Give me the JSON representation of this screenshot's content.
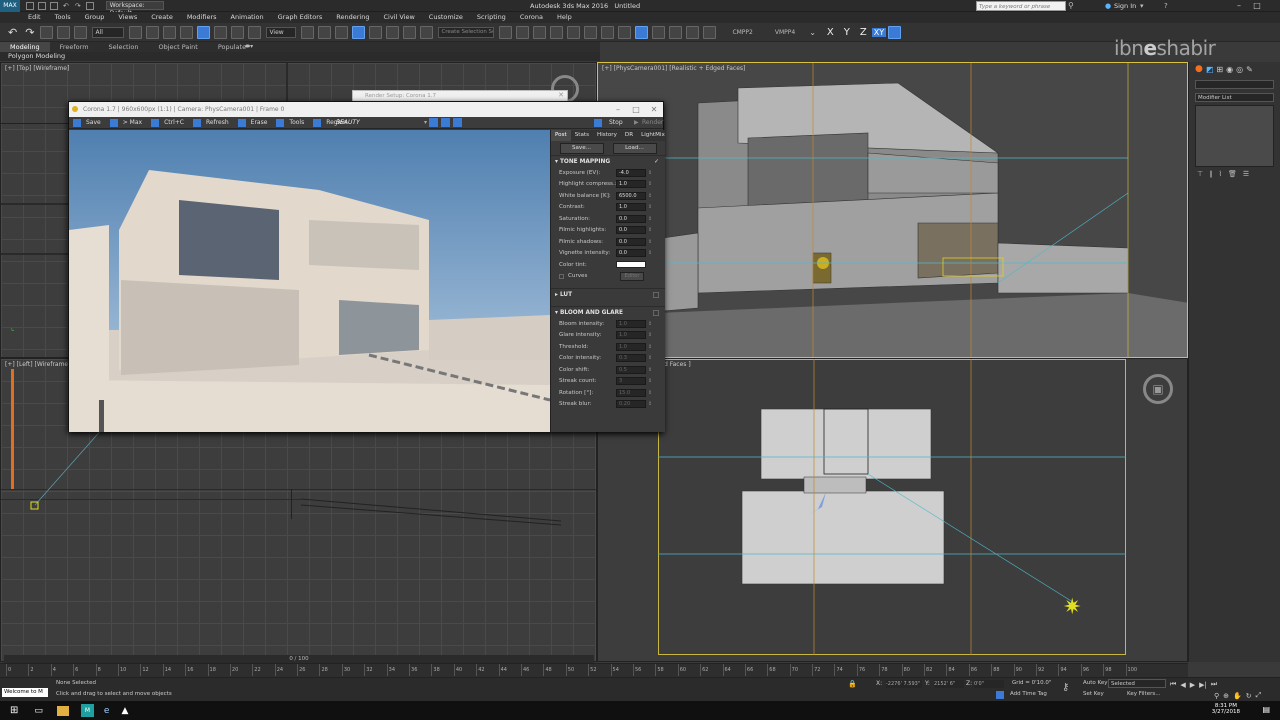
{
  "app": {
    "title": "Autodesk 3ds Max 2016",
    "doc_title": "Untitled",
    "workspace": "Workspace: Default",
    "search_placeholder": "Type a keyword or phrase",
    "sign_in": "Sign In",
    "watermark": "ibn e shabir"
  },
  "menu": [
    "Edit",
    "Tools",
    "Group",
    "Views",
    "Create",
    "Modifiers",
    "Animation",
    "Graph Editors",
    "Rendering",
    "Civil View",
    "Customize",
    "Scripting",
    "Corona",
    "Help"
  ],
  "toolbar": {
    "selection_filter": "All",
    "view_mode": "View",
    "selection_set": "Create Selection Se",
    "cmpp2": "CMPP2",
    "vmpp4": "VMPP4",
    "axis_x": "X",
    "axis_y": "Y",
    "axis_z": "Z",
    "axis_xy": "XY"
  },
  "ribbon": {
    "tabs": [
      "Modeling",
      "Freeform",
      "Selection",
      "Object Paint",
      "Populate"
    ],
    "sub_label": "Polygon Modeling"
  },
  "viewports": {
    "top": "[+] [Top] [Wireframe]",
    "left": "[+] [Left] [Wireframe]",
    "camera": "[+] [PhysCamera001] [Realistic + Edged Faces]",
    "front_suffix": "d Faces ]"
  },
  "render_setup": {
    "title": "Render Setup: Corona 1.7"
  },
  "vfb": {
    "title": "Corona 1.7 | 960x600px (1:1) | Camera: PhysCamera001 | Frame 0",
    "toolbar": [
      "Save",
      "> Max",
      "Ctrl+C",
      "Refresh",
      "Erase",
      "Tools",
      "Region"
    ],
    "render_elem": "BEAUTY",
    "stop": "Stop",
    "render": "Render",
    "tabs": [
      "Post",
      "Stats",
      "History",
      "DR",
      "LightMix"
    ],
    "save_btn": "Save...",
    "load_btn": "Load...",
    "tone_mapping": "TONE MAPPING",
    "tone_rows": [
      {
        "label": "Exposure (EV):",
        "value": "-4.0"
      },
      {
        "label": "Highlight compress.:",
        "value": "1.0"
      },
      {
        "label": "White balance [K]:",
        "value": "6500.0"
      },
      {
        "label": "Contrast:",
        "value": "1.0"
      },
      {
        "label": "Saturation:",
        "value": "0.0"
      },
      {
        "label": "Filmic highlights:",
        "value": "0.0"
      },
      {
        "label": "Filmic shadows:",
        "value": "0.0"
      },
      {
        "label": "Vignette intensity:",
        "value": "0.0"
      }
    ],
    "color_tint": "Color tint:",
    "curves": "Curves",
    "curves_btn": "Editor",
    "lut": "LUT",
    "bloom": "BLOOM AND GLARE",
    "bloom_rows": [
      {
        "label": "Bloom intensity:",
        "value": "1.0"
      },
      {
        "label": "Glare intensity:",
        "value": "1.0"
      },
      {
        "label": "Threshold:",
        "value": "1.0"
      },
      {
        "label": "Color intensity:",
        "value": "0.3"
      },
      {
        "label": "Color shift:",
        "value": "0.5"
      },
      {
        "label": "Streak count:",
        "value": "3"
      },
      {
        "label": "Rotation [°]:",
        "value": "15.0"
      },
      {
        "label": "Streak blur:",
        "value": "0.20"
      }
    ]
  },
  "cmdpanel": {
    "modifier_list": "Modifier List"
  },
  "timeline": {
    "frame": "0 / 100",
    "ticks": [
      "0",
      "2",
      "4",
      "6",
      "8",
      "10",
      "12",
      "14",
      "16",
      "18",
      "20",
      "22",
      "24",
      "26",
      "28",
      "30",
      "32",
      "34",
      "36",
      "38",
      "40",
      "42",
      "44",
      "46",
      "48",
      "50",
      "52",
      "54",
      "56",
      "58",
      "60",
      "62",
      "64",
      "66",
      "68",
      "70",
      "72",
      "74",
      "76",
      "78",
      "80",
      "82",
      "84",
      "86",
      "88",
      "90",
      "92",
      "94",
      "96",
      "98",
      "100"
    ]
  },
  "status": {
    "maxscript": "Welcome to M",
    "selection": "None Selected",
    "prompt": "Click and drag to select and move objects",
    "x_label": "X:",
    "x_value": "-2276' 7.593\"",
    "y_label": "Y:",
    "y_value": "2152' 6\"",
    "z_label": "Z:",
    "z_value": "0'0\"",
    "grid": "Grid = 0'10.0\"",
    "auto_key": "Auto Key",
    "set_key": "Set Key",
    "key_mode": "Selected",
    "key_filters": "Key Filters...",
    "add_time_tag": "Add Time Tag"
  },
  "taskbar": {
    "time": "8:31 PM",
    "date": "3/27/2018"
  }
}
